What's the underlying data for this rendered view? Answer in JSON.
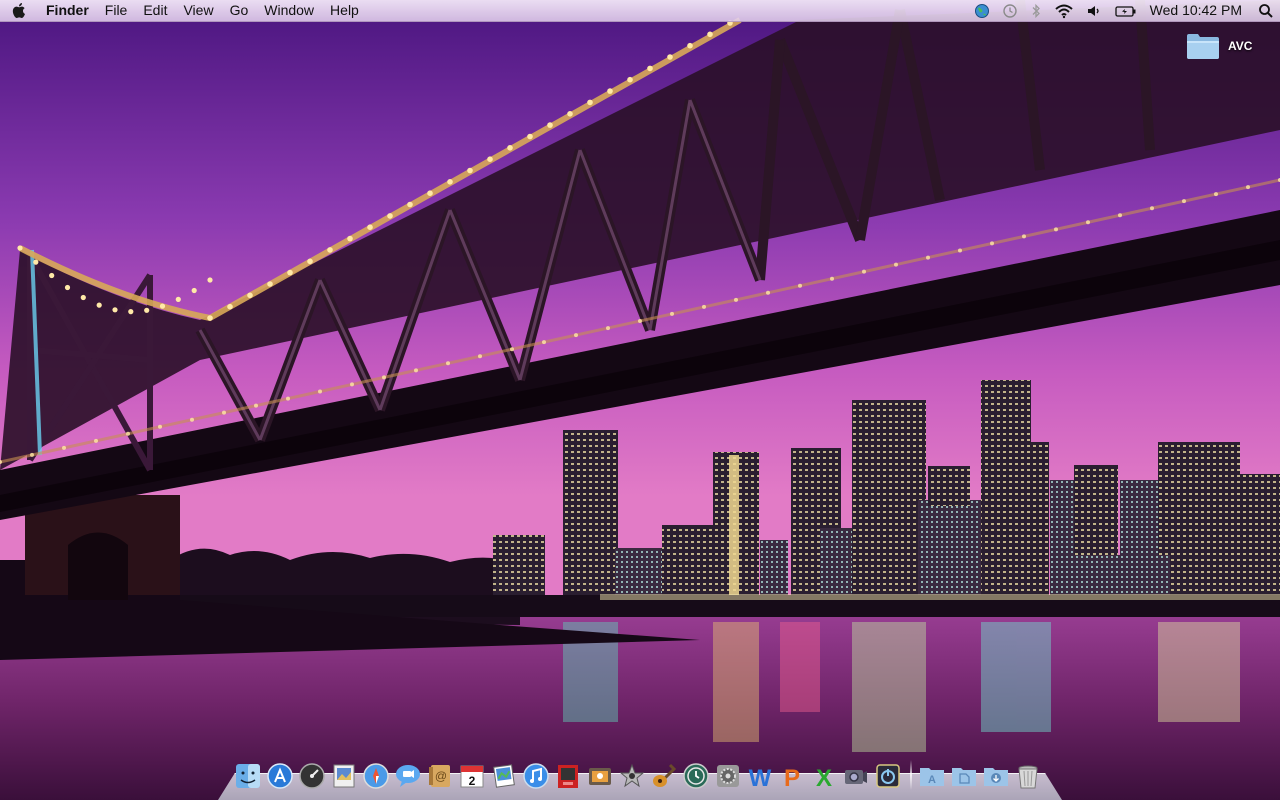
{
  "menubar": {
    "apple_icon": "apple-icon",
    "app_name": "Finder",
    "menus": [
      "File",
      "Edit",
      "View",
      "Go",
      "Window",
      "Help"
    ],
    "status_icons": [
      "network-globe-icon",
      "time-machine-icon",
      "bluetooth-icon",
      "wifi-icon",
      "volume-icon",
      "battery-icon"
    ],
    "clock": "Wed 10:42 PM",
    "spotlight_icon": "spotlight-search-icon"
  },
  "desktop": {
    "folder_label": "AVC"
  },
  "dock": {
    "apps": [
      {
        "name": "finder",
        "icon": "finder-icon"
      },
      {
        "name": "app-store",
        "icon": "app-store-icon"
      },
      {
        "name": "dashboard",
        "icon": "dashboard-icon"
      },
      {
        "name": "preview",
        "icon": "preview-icon"
      },
      {
        "name": "safari",
        "icon": "safari-icon"
      },
      {
        "name": "ichat",
        "icon": "ichat-icon"
      },
      {
        "name": "address-book",
        "icon": "address-book-icon"
      },
      {
        "name": "ical",
        "icon": "calendar-icon",
        "text": "2"
      },
      {
        "name": "iphoto",
        "icon": "iphoto-icon"
      },
      {
        "name": "itunes",
        "icon": "itunes-icon"
      },
      {
        "name": "photo-booth",
        "icon": "photo-booth-icon"
      },
      {
        "name": "image-capture",
        "icon": "image-capture-icon"
      },
      {
        "name": "imovie",
        "icon": "imovie-icon"
      },
      {
        "name": "garageband",
        "icon": "garageband-icon"
      },
      {
        "name": "time-machine",
        "icon": "time-machine-dock-icon"
      },
      {
        "name": "system-preferences",
        "icon": "system-preferences-icon"
      },
      {
        "name": "word",
        "icon": "word-icon",
        "text": "W"
      },
      {
        "name": "powerpoint",
        "icon": "powerpoint-icon",
        "text": "P"
      },
      {
        "name": "excel",
        "icon": "excel-icon",
        "text": "X"
      },
      {
        "name": "screen-capture",
        "icon": "camera-icon"
      },
      {
        "name": "activity",
        "icon": "power-icon"
      }
    ],
    "stacks": [
      {
        "name": "applications",
        "icon": "applications-folder-icon",
        "text": "A"
      },
      {
        "name": "documents",
        "icon": "documents-folder-icon"
      },
      {
        "name": "downloads",
        "icon": "downloads-folder-icon"
      },
      {
        "name": "trash",
        "icon": "trash-icon"
      }
    ]
  },
  "colors": {
    "sky_top": "#5a1a8c",
    "sky_mid": "#a048b0",
    "sky_horizon": "#e070c8",
    "water": "#7a2a78",
    "bridge": "#1a0a18",
    "bridge_lights": "#ffe08a"
  }
}
